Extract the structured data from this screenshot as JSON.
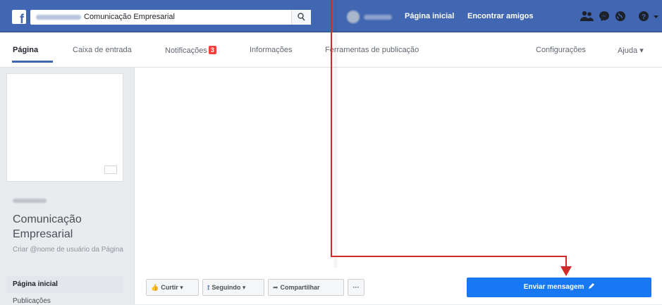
{
  "topbar": {
    "search_value": "Comunicação Empresarial",
    "home_link": "Página inicial",
    "find_friends_link": "Encontrar amigos"
  },
  "tabs": [
    {
      "label": "Página"
    },
    {
      "label": "Caixa de entrada"
    },
    {
      "label": "Notificações",
      "badge": "3"
    },
    {
      "label": "Informações"
    },
    {
      "label": "Ferramentas de publicação"
    },
    {
      "label": "Configurações"
    },
    {
      "label": "Ajuda ▾"
    }
  ],
  "sidebar": {
    "page_name": "Comunicação Empresarial",
    "create_username": "Criar @nome de usuário da Página",
    "nav_active": "Página inicial",
    "nav_next": "Publicações"
  },
  "actions": {
    "like": "Curtir ▾",
    "following": "Seguindo ▾",
    "share": "Compartilhar",
    "more": "···",
    "send_message": "Enviar mensagem"
  },
  "colors": {
    "brand_blue": "#4267b2",
    "button_blue": "#1877f2",
    "annotation_red": "#d02a2a"
  }
}
